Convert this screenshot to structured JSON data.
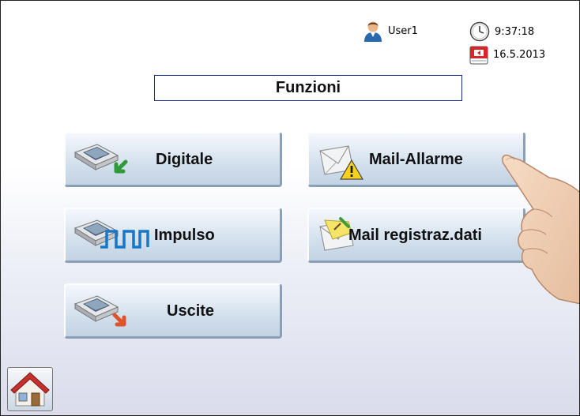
{
  "status": {
    "user": "User1",
    "time": "9:37:18",
    "date": "16.5.2013"
  },
  "title": "Funzioni",
  "buttons": {
    "digitale": "Digitale",
    "impulso": "Impulso",
    "uscite": "Uscite",
    "mail_allarme": "Mail-Allarme",
    "mail_registraz": "Mail registraz.dati"
  },
  "icons": [
    "user-icon",
    "clock-icon",
    "calendar-icon",
    "device-input-icon",
    "pulse-icon",
    "device-output-icon",
    "mail-warning-icon",
    "mail-edit-icon",
    "home-icon",
    "hand-pointer-icon"
  ],
  "colors": {
    "title_border": "#1b2d8c",
    "button_face": "#d3e0ed",
    "pulse_blue": "#1577c9"
  }
}
